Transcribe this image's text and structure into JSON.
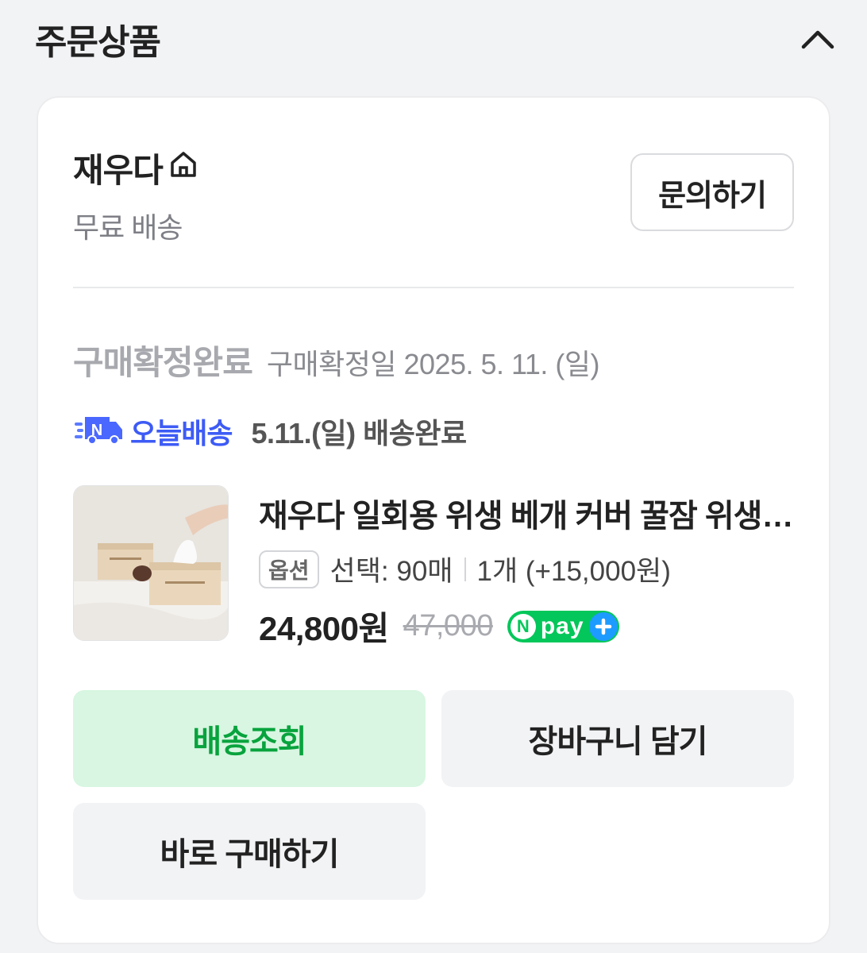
{
  "section": {
    "title": "주문상품",
    "collapse_icon": "chevron-up-icon"
  },
  "seller": {
    "name": "재우다",
    "store_icon": "home-icon",
    "shipping": "무료 배송",
    "inquiry_label": "문의하기"
  },
  "status": {
    "main": "구매확정완료",
    "date": "구매확정일 2025. 5. 11. (일)"
  },
  "delivery": {
    "badge_label": "오늘배송",
    "badge_icon": "truck-icon",
    "text": "5.11.(일) 배송완료"
  },
  "product": {
    "title": "재우다 일회용 위생 베개 커버 꿀잠 위생 필수템",
    "option_badge": "옵션",
    "option_text": "선택: 90매",
    "quantity_text": "1개 (+15,000원)",
    "price": "24,800원",
    "original_price": "47,000",
    "npay": {
      "n": "N",
      "text": "pay"
    }
  },
  "buttons": {
    "track": "배송조회",
    "cart": "장바구니 담기",
    "buy": "바로 구매하기"
  },
  "colors": {
    "accent_green": "#08a33d",
    "track_bg": "#d8f6e1",
    "today_blue": "#3d5bf5",
    "npay_green": "#03c75a"
  }
}
